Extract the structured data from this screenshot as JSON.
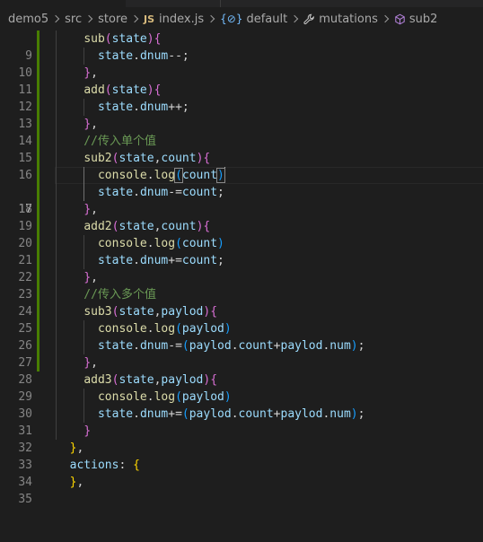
{
  "breadcrumb": {
    "items": [
      "demo5",
      "src",
      "store",
      "index.js",
      "default",
      "mutations",
      "sub2"
    ],
    "icons": [
      "",
      "",
      "",
      "js-icon",
      "default-icon",
      "wrench-icon",
      "cube-icon"
    ]
  },
  "editor": {
    "current_line": 17,
    "lines": [
      {
        "num": "9",
        "text": "    sub(state){"
      },
      {
        "num": "10",
        "text": "      state.dnum--;"
      },
      {
        "num": "11",
        "text": "    },"
      },
      {
        "num": "12",
        "text": "    add(state){"
      },
      {
        "num": "13",
        "text": "      state.dnum++;"
      },
      {
        "num": "14",
        "text": "    },"
      },
      {
        "num": "15",
        "text": "    //传入单个值"
      },
      {
        "num": "16",
        "text": "    sub2(state,count){"
      },
      {
        "num": "17",
        "text": "      console.log(count)"
      },
      {
        "num": "18",
        "text": "      state.dnum-=count;"
      },
      {
        "num": "19",
        "text": "    },"
      },
      {
        "num": "20",
        "text": "    add2(state,count){"
      },
      {
        "num": "21",
        "text": "      console.log(count)"
      },
      {
        "num": "22",
        "text": "      state.dnum+=count;"
      },
      {
        "num": "23",
        "text": "    },"
      },
      {
        "num": "24",
        "text": "    //传入多个值"
      },
      {
        "num": "25",
        "text": "    sub3(state,paylod){"
      },
      {
        "num": "26",
        "text": "      console.log(paylod)"
      },
      {
        "num": "27",
        "text": "      state.dnum-=(paylod.count+paylod.num);"
      },
      {
        "num": "28",
        "text": "    },"
      },
      {
        "num": "29",
        "text": "    add3(state,paylod){"
      },
      {
        "num": "30",
        "text": "      console.log(paylod)"
      },
      {
        "num": "31",
        "text": "      state.dnum+=(paylod.count+paylod.num);"
      },
      {
        "num": "32",
        "text": "    }"
      },
      {
        "num": "33",
        "text": "  },"
      },
      {
        "num": "34",
        "text": "  actions: {"
      },
      {
        "num": "35",
        "text": "  },"
      }
    ]
  },
  "colors": {
    "background": "#1e1e1e",
    "line_number": "#858585",
    "function": "#dcdcaa",
    "variable": "#9cdcfe",
    "comment": "#6a9955",
    "bracket_level1": "#ffd700",
    "bracket_level2": "#da70d6",
    "bracket_level3": "#179fff",
    "gutter_modified": "#487e02"
  }
}
